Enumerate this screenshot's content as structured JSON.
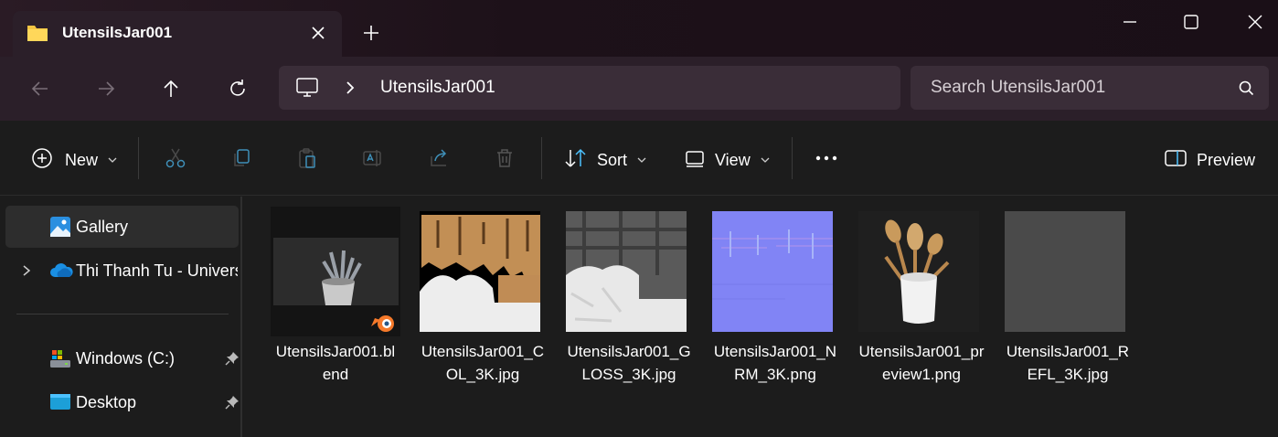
{
  "window": {
    "tab_title": "UtensilsJar001",
    "icons": [
      "folder-icon",
      "close-icon",
      "plus-icon",
      "minimize-icon",
      "maximize-icon",
      "window-close-icon"
    ]
  },
  "address": {
    "path": "UtensilsJar001",
    "search_placeholder": "Search UtensilsJar001"
  },
  "toolbar": {
    "new_label": "New",
    "sort_label": "Sort",
    "view_label": "View",
    "preview_label": "Preview"
  },
  "sidebar": {
    "items": [
      {
        "label": "Gallery"
      },
      {
        "label": "Thi Thanh Tu - Universi"
      },
      {
        "label": "Windows (C:)"
      },
      {
        "label": "Desktop"
      }
    ]
  },
  "files": [
    {
      "name": "UtensilsJar001.blend",
      "line1": "UtensilsJar001.bl",
      "line2": "end"
    },
    {
      "name": "UtensilsJar001_COL_3K.jpg",
      "line1": "UtensilsJar001_C",
      "line2": "OL_3K.jpg"
    },
    {
      "name": "UtensilsJar001_GLOSS_3K.jpg",
      "line1": "UtensilsJar001_G",
      "line2": "LOSS_3K.jpg"
    },
    {
      "name": "UtensilsJar001_NRM_3K.png",
      "line1": "UtensilsJar001_N",
      "line2": "RM_3K.png"
    },
    {
      "name": "UtensilsJar001_preview1.png",
      "line1": "UtensilsJar001_pr",
      "line2": "eview1.png"
    },
    {
      "name": "UtensilsJar001_REFL_3K.jpg",
      "line1": "UtensilsJar001_R",
      "line2": "EFL_3K.jpg"
    }
  ],
  "colors": {
    "accent": "#4cc2ff",
    "titlebar": "#1d1119",
    "panel": "#2b1f29",
    "body": "#1c1c1c"
  }
}
